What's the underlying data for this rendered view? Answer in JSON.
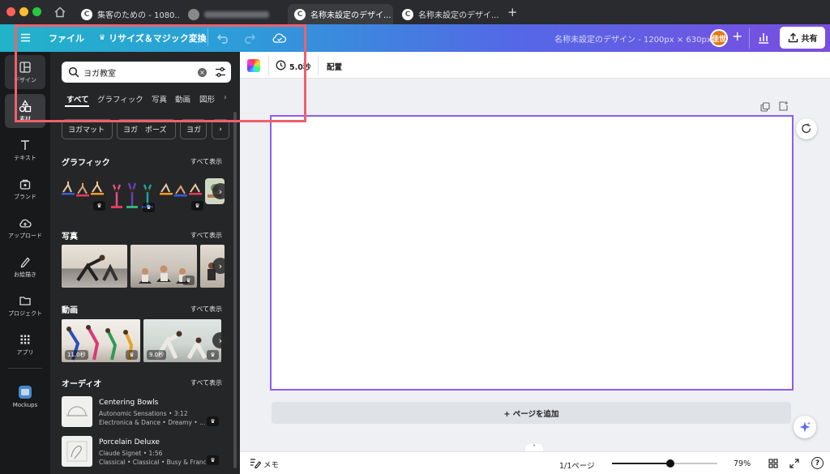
{
  "browser": {
    "tabs": [
      {
        "label": "集客のための - 1080...",
        "favicon": "C",
        "active": false
      },
      {
        "label": "",
        "favicon": "",
        "active": false
      },
      {
        "label": "名称未設定のデザイ...",
        "favicon": "C",
        "active": true
      },
      {
        "label": "名称未設定のデザイ...",
        "favicon": "C",
        "active": false
      }
    ],
    "new_tab": "+",
    "close_glyph": "×"
  },
  "header": {
    "file_label": "ファイル",
    "resize_label": "リサイズ＆マジック変換",
    "doc_title": "名称未設定のデザイン - 1200px × 630px",
    "avatar_text": "佳世",
    "share_label": "共有"
  },
  "rail": {
    "items": [
      {
        "label": "デザイン",
        "icon": "layout-icon"
      },
      {
        "label": "素材",
        "icon": "elements-icon"
      },
      {
        "label": "テキスト",
        "icon": "text-icon"
      },
      {
        "label": "ブランド",
        "icon": "brand-icon"
      },
      {
        "label": "アップロード",
        "icon": "upload-icon"
      },
      {
        "label": "お絵描き",
        "icon": "draw-icon"
      },
      {
        "label": "プロジェクト",
        "icon": "folder-icon"
      },
      {
        "label": "アプリ",
        "icon": "apps-icon"
      },
      {
        "label": "Mockups",
        "icon": "mockups-icon"
      }
    ]
  },
  "panel": {
    "search_value": "ヨガ教室",
    "filter_tabs": [
      "すべて",
      "グラフィック",
      "写真",
      "動画",
      "図形"
    ],
    "chips": [
      "ヨガマット",
      "ヨガ　ポーズ",
      "ヨガ"
    ],
    "see_all": "すべて表示",
    "sections": {
      "graphics": "グラフィック",
      "photos": "写真",
      "videos": "動画",
      "audio": "オーディオ"
    },
    "video_durations": [
      "11.0秒",
      "9.0秒"
    ],
    "audio": [
      {
        "title": "Centering Bowls",
        "artist_line": "Autonomic Sensations • 3:12",
        "genre_line": "Electronica & Dance • Dreamy • ..."
      },
      {
        "title": "Porcelain Deluxe",
        "artist_line": "Claude Signet • 1:56",
        "genre_line": "Classical • Classical • Busy & Franc..."
      }
    ],
    "crown_glyph": "♛"
  },
  "editor": {
    "duration_label": "5.0秒",
    "position_label": "配置",
    "add_page_label": "+ ページを追加",
    "notes_label": "メモ",
    "page_counter": "1/1ページ",
    "zoom_label": "79%",
    "zoom_level_percent": 79,
    "help_label": "?"
  },
  "colors": {
    "highlight_box": "#f0606a",
    "canvas_border": "#8b5cf6",
    "header_start": "#22b3c9",
    "header_end": "#7a4de0",
    "avatar": "#e07b1a"
  }
}
